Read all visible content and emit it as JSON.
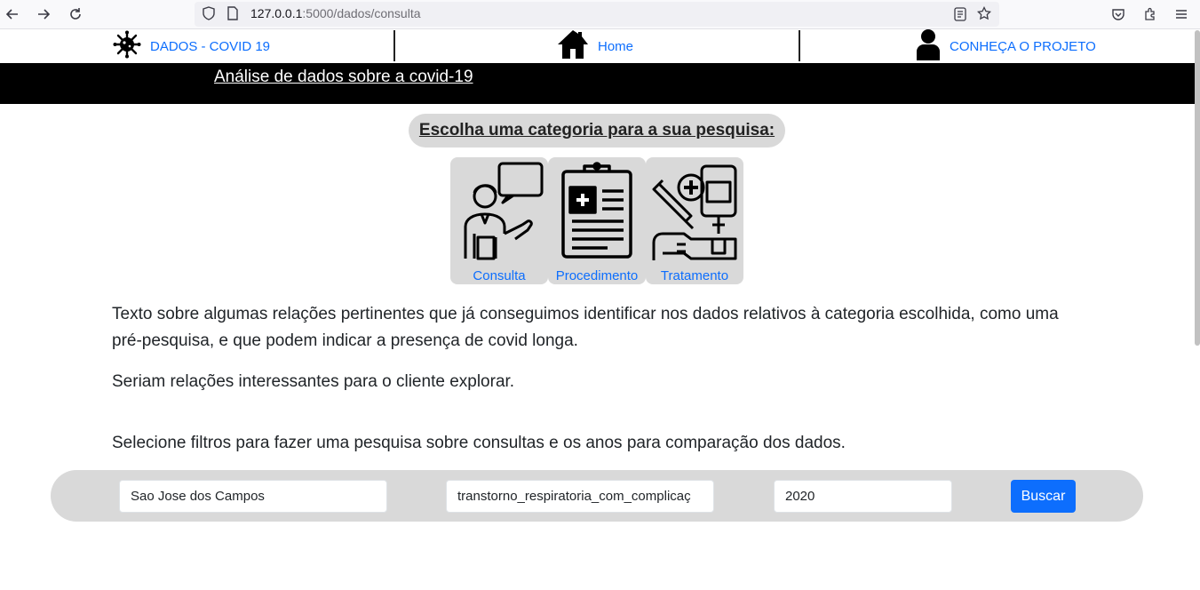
{
  "browser": {
    "url_host": "127.0.0.1",
    "url_rest": ":5000/dados/consulta"
  },
  "nav": {
    "brand": "DADOS - COVID 19",
    "home": "Home",
    "project": "CONHEÇA O PROJETO"
  },
  "title_bar": {
    "title": "Análise de dados sobre a covid-19"
  },
  "category": {
    "heading": "Escolha uma categoria para a sua pesquisa:",
    "items": [
      {
        "label": "Consulta",
        "icon": "doctor-consultation-icon"
      },
      {
        "label": "Procedimento",
        "icon": "clipboard-medical-icon"
      },
      {
        "label": "Tratamento",
        "icon": "treatment-icon"
      }
    ]
  },
  "text": {
    "p1": "Texto sobre algumas relações pertinentes que já conseguimos identificar nos dados relativos à categoria escolhida, como uma pré-pesquisa, e que podem indicar a presença de covid longa.",
    "p2": "Seriam relações interessantes para o cliente explorar.",
    "p3": "Selecione filtros para fazer uma pesquisa sobre consultas e os anos para comparação dos dados."
  },
  "filters": {
    "city": "Sao Jose dos Campos",
    "condition": "transtorno_respiratoria_com_complicaç",
    "year": "2020",
    "search_button": "Buscar"
  },
  "colors": {
    "link": "#0d6efd",
    "panel": "#d9d9d9",
    "title_bar": "#000000"
  }
}
